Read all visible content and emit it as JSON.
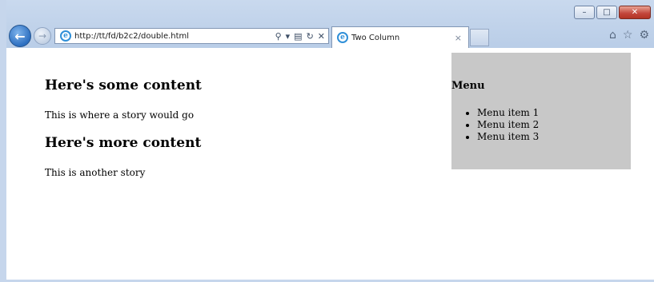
{
  "browser": {
    "url": "http://tt/fd/b2c2/double.html",
    "tab_title": "Two Column",
    "tab_close": "×",
    "window_controls": {
      "minimize": "–",
      "maximize": "□",
      "close": "✕"
    },
    "icons": {
      "back": "back-arrow-icon",
      "forward": "forward-arrow-icon",
      "home": "home-icon",
      "favorites": "star-icon",
      "tools": "gear-icon"
    }
  },
  "page": {
    "main": [
      {
        "heading": "Here's some content",
        "body": "This is where a story would go"
      },
      {
        "heading": "Here's more content",
        "body": "This is another story"
      }
    ],
    "sidebar": {
      "heading": "Menu",
      "items": [
        "Menu item 1",
        "Menu item 2",
        "Menu item 3"
      ],
      "background": "#c8c8c8"
    }
  }
}
